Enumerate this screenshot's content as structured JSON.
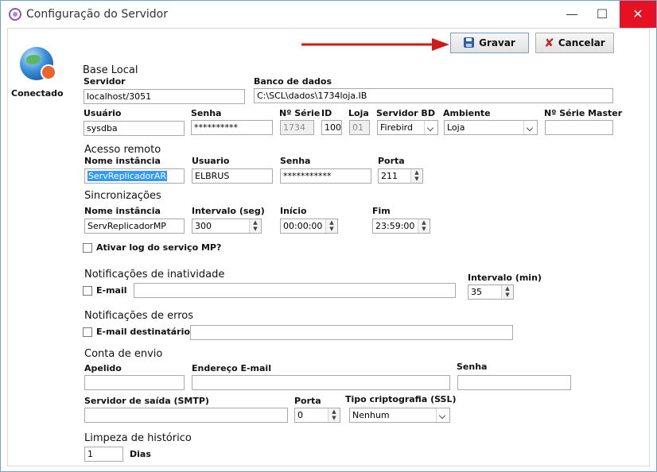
{
  "window": {
    "title": "Configuração do Servidor",
    "minimize": "—",
    "maximize": "☐",
    "close": "✕"
  },
  "toolbar": {
    "save_label": "Gravar",
    "cancel_label": "Cancelar"
  },
  "status": {
    "label": "Conectado"
  },
  "base_local": {
    "section": "Base Local",
    "servidor_label": "Servidor",
    "servidor_value": "localhost/3051",
    "banco_label": "Banco de dados",
    "banco_value": "C:\\SCL\\dados\\1734loja.IB",
    "usuario_label": "Usuário",
    "usuario_value": "sysdba",
    "senha_label": "Senha",
    "senha_value": "**********",
    "nserie_label": "Nº Série",
    "nserie_value": "1734",
    "id_label": "ID",
    "id_value": "100",
    "loja_label": "Loja",
    "loja_value": "01",
    "servidor_bd_label": "Servidor BD",
    "servidor_bd_value": "Firebird",
    "ambiente_label": "Ambiente",
    "ambiente_value": "Loja",
    "nserie_master_label": "Nº Série Master",
    "nserie_master_value": ""
  },
  "acesso_remoto": {
    "section": "Acesso remoto",
    "instancia_label": "Nome instância",
    "instancia_value": "ServReplicadorAR",
    "usuario_label": "Usuario",
    "usuario_value": "ELBRUS",
    "senha_label": "Senha",
    "senha_value": "***********",
    "porta_label": "Porta",
    "porta_value": "211"
  },
  "sincronizacoes": {
    "section": "Sincronizações",
    "instancia_label": "Nome instância",
    "instancia_value": "ServReplicadorMP",
    "intervalo_label": "Intervalo (seg)",
    "intervalo_value": "300",
    "inicio_label": "Início",
    "inicio_value": "00:00:00",
    "fim_label": "Fim",
    "fim_value": "23:59:00",
    "log_label": "Ativar log do serviço MP?"
  },
  "inatividade": {
    "section": "Notificações de inatividade",
    "email_label": "E-mail",
    "email_value": "",
    "intervalo_label": "Intervalo (min)",
    "intervalo_value": "35"
  },
  "erros": {
    "section": "Notificações de erros",
    "email_label": "E-mail destinatários",
    "email_value": ""
  },
  "conta_envio": {
    "section": "Conta de envio",
    "apelido_label": "Apelido",
    "apelido_value": "",
    "endereco_label": "Endereço E-mail",
    "endereco_value": "",
    "senha_label": "Senha",
    "senha_value": "",
    "smtp_label": "Servidor de saída (SMTP)",
    "smtp_value": "",
    "porta_label": "Porta",
    "porta_value": "0",
    "cripto_label": "Tipo criptografia (SSL)",
    "cripto_value": "Nenhum"
  },
  "limpeza": {
    "section": "Limpeza de histórico",
    "dias_value": "1",
    "dias_label": "Dias"
  }
}
